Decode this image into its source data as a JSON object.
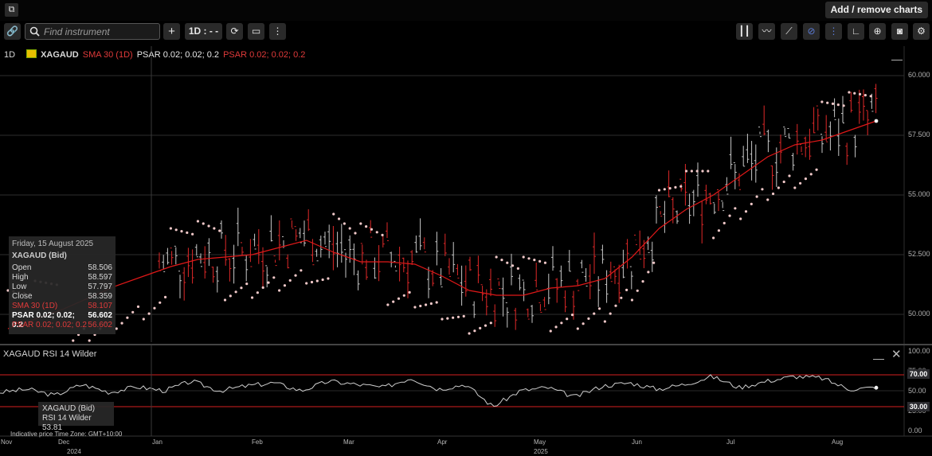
{
  "topbar": {
    "popout_icon": "popout-icon",
    "add_remove_label": "Add / remove charts"
  },
  "toolbar": {
    "link_icon": "link-icon",
    "search_placeholder": "Find instrument",
    "add_label": "+",
    "period_label": "1D : - -",
    "refresh_icon": "refresh-icon",
    "layout_icon": "layout-icon",
    "more_icon": "more-vertical-icon",
    "right_tools": [
      "candle-type-icon",
      "indicators-icon",
      "draw-line-icon",
      "hide-drawings-icon",
      "annotations-icon",
      "axis-scale-icon",
      "zoom-icon",
      "screenshot-icon",
      "settings-icon"
    ]
  },
  "legend": {
    "period": "1D",
    "symbol": "XAGAUD",
    "sma": "SMA 30 (1D)",
    "psar_white": "PSAR 0.02; 0.02; 0.2",
    "psar_red": "PSAR 0.02; 0.02; 0.2"
  },
  "tooltip": {
    "date": "Friday, 15 August 2025",
    "symbol": "XAGAUD (Bid)",
    "rows": [
      {
        "label": "Open",
        "value": "58.506"
      },
      {
        "label": "High",
        "value": "58.597"
      },
      {
        "label": "Low",
        "value": "57.797"
      },
      {
        "label": "Close",
        "value": "58.359"
      },
      {
        "label": "SMA 30 (1D)",
        "value": "58.107"
      },
      {
        "label": "PSAR 0.02; 0.02; 0.2",
        "value": "56.602"
      },
      {
        "label": "PSAR 0.02; 0.02; 0.2",
        "value": "56.602"
      }
    ]
  },
  "price_axis": [
    "60.000",
    "57.500",
    "55.000",
    "52.500",
    "50.000"
  ],
  "rsi": {
    "title": "XAGAUD  RSI 14 Wilder",
    "tooltip_symbol": "XAGAUD (Bid)",
    "tooltip_value": "RSI 14 Wilder  53.81",
    "axis": [
      "100.00",
      "75.00",
      "50.00",
      "25.00",
      "0.00"
    ],
    "upper_badge": "70.00",
    "lower_badge": "30.00"
  },
  "footer": {
    "indicative": "Indicative price    Time Zone: GMT+10:00",
    "months": [
      "Nov",
      "Dec",
      "Jan",
      "Feb",
      "Mar",
      "Apr",
      "May",
      "Jun",
      "Jul",
      "Aug"
    ],
    "years": [
      "2024",
      "2025"
    ]
  },
  "colors": {
    "bar_up": "#c8c8c8",
    "bar_down": "#e02828",
    "sma": "#e01818",
    "psar": "#f0c8c8",
    "rsi_line": "#cfcfcf",
    "rsi_bands": "#d42020"
  },
  "chart_data": {
    "type": "line",
    "instrument": "XAGAUD",
    "timeframe": "1D",
    "ylim": [
      48.8,
      60.8
    ],
    "yticks": [
      50.0,
      52.5,
      55.0,
      57.5,
      60.0
    ],
    "sma_30": [
      49.4,
      49.8,
      50.2,
      50.7,
      51.2,
      51.6,
      52.0,
      52.3,
      52.4,
      52.5,
      52.8,
      53.1,
      52.6,
      52.2,
      52.2,
      52.1,
      51.6,
      51.0,
      50.8,
      50.8,
      51.1,
      51.2,
      51.5,
      52.4,
      53.6,
      54.4,
      55.0,
      55.8,
      56.6,
      57.1,
      57.3,
      57.7,
      58.1
    ],
    "rsi_14": [
      48,
      52,
      44,
      58,
      48,
      55,
      50,
      62,
      50,
      56,
      60,
      50,
      62,
      58,
      54,
      66,
      52,
      58,
      30,
      50,
      54,
      42,
      56,
      60,
      52,
      58,
      68,
      54,
      62,
      68,
      66,
      52,
      54
    ]
  }
}
